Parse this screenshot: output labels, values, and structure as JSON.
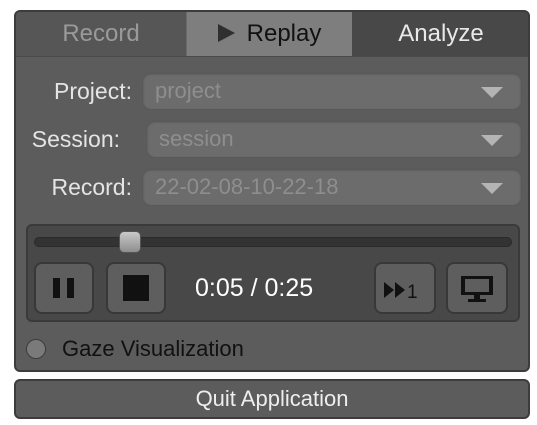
{
  "tabs": {
    "record": "Record",
    "replay": "Replay",
    "analyze": "Analyze",
    "active": "Replay"
  },
  "form": {
    "project_label": "Project:",
    "project_value": "project",
    "session_label": "Session:",
    "session_value": "session",
    "record_label": "Record:",
    "record_value": "22-02-08-10-22-18"
  },
  "player": {
    "time": "0:05 / 0:25",
    "position_fraction": 0.2,
    "step_label": "1",
    "icons": [
      "pause-icon",
      "stop-icon",
      "fast-forward-icon",
      "monitor-icon"
    ]
  },
  "gaze": {
    "label": "Gaze Visualization",
    "checked": false
  },
  "quit_label": "Quit Application",
  "colors": {
    "panel": "#5c5c5c",
    "active_tab": "#7e7e7e",
    "player_bg": "#484848"
  }
}
